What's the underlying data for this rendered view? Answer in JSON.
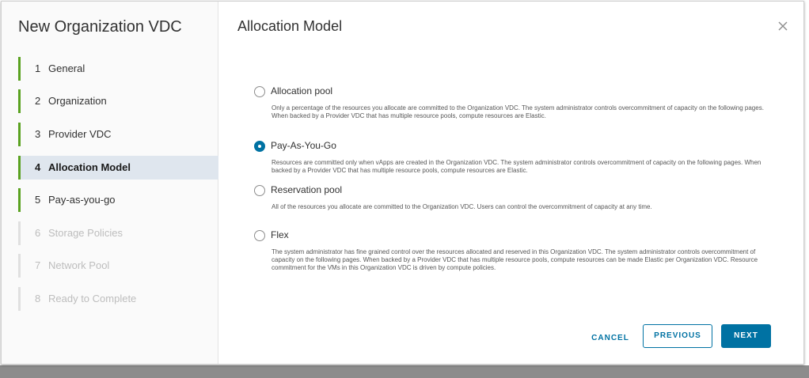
{
  "wizard": {
    "title": "New Organization VDC",
    "steps": [
      {
        "num": "1",
        "label": "General",
        "state": "done"
      },
      {
        "num": "2",
        "label": "Organization",
        "state": "done"
      },
      {
        "num": "3",
        "label": "Provider VDC",
        "state": "done"
      },
      {
        "num": "4",
        "label": "Allocation Model",
        "state": "active"
      },
      {
        "num": "5",
        "label": "Pay-as-you-go",
        "state": "available"
      },
      {
        "num": "6",
        "label": "Storage Policies",
        "state": "disabled"
      },
      {
        "num": "7",
        "label": "Network Pool",
        "state": "disabled"
      },
      {
        "num": "8",
        "label": "Ready to Complete",
        "state": "disabled"
      }
    ]
  },
  "page": {
    "title": "Allocation Model",
    "close_icon": "close-icon"
  },
  "options": [
    {
      "label": "Allocation pool",
      "selected": false,
      "description": "Only a percentage of the resources you allocate are committed to the Organization VDC. The system administrator controls overcommitment of capacity on the following pages. When backed by a Provider VDC that has multiple resource pools, compute resources are Elastic."
    },
    {
      "label": "Pay-As-You-Go",
      "selected": true,
      "description": "Resources are committed only when vApps are created in the Organization VDC. The system administrator controls overcommitment of capacity on the following pages. When backed by a Provider VDC that has multiple resource pools, compute resources are Elastic."
    },
    {
      "label": "Reservation pool",
      "selected": false,
      "description": "All of the resources you allocate are committed to the Organization VDC. Users can control the overcommitment of capacity at any time."
    },
    {
      "label": "Flex",
      "selected": false,
      "description": "The system administrator has fine grained control over the resources allocated and reserved in this Organization VDC. The system administrator controls overcommitment of capacity on the following pages. When backed by a Provider VDC that has multiple resource pools, compute resources can be made Elastic per Organization VDC. Resource commitment for the VMs in this Organization VDC is driven by compute policies."
    }
  ],
  "footer": {
    "cancel_label": "CANCEL",
    "previous_label": "PREVIOUS",
    "next_label": "NEXT"
  },
  "colors": {
    "accent": "#0072a3",
    "step_complete": "#5aa220",
    "active_step_bg": "#dfe6ee"
  }
}
